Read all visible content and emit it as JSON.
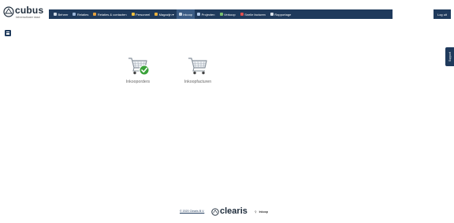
{
  "logo": {
    "name": "cubus",
    "tagline": "beheersoftware totaal"
  },
  "nav": {
    "items": [
      {
        "label": "Beheer",
        "icon": "gear-icon",
        "color": "#cfd8e3"
      },
      {
        "label": "Relaties",
        "icon": "users-icon",
        "color": "#9ab4d6"
      },
      {
        "label": "Relaties & contacten",
        "icon": "contacts-icon",
        "color": "#e2a040"
      },
      {
        "label": "Personeel",
        "icon": "staff-icon",
        "color": "#f0c040"
      },
      {
        "label": "Magazijn",
        "icon": "warehouse-icon",
        "color": "#e8b040",
        "dropdown": "▾"
      },
      {
        "label": "Inkoop",
        "icon": "cart-icon",
        "color": "#c9d6e6",
        "active": true
      },
      {
        "label": "Projecten",
        "icon": "projects-icon",
        "color": "#b0c8e8"
      },
      {
        "label": "Verkoop",
        "icon": "sales-icon",
        "color": "#7ac070"
      },
      {
        "label": "Snelle facturen",
        "icon": "invoice-icon",
        "color": "#e05050"
      },
      {
        "label": "Rapportage",
        "icon": "report-icon",
        "color": "#d8e0ea"
      }
    ],
    "logout": "Log uit"
  },
  "support_label": "Support",
  "tiles": [
    {
      "label": "Inkooporders",
      "icon": "shopping-cart-check-icon"
    },
    {
      "label": "Inkoopfacturen",
      "icon": "shopping-cart-icon"
    }
  ],
  "footer": {
    "copyright": "© 2020 Clearis B.V.",
    "brand": "clearis",
    "section": "Inkoop"
  },
  "colors": {
    "nav_bg": "#1f3a5c",
    "nav_active": "#3b5c85",
    "check": "#3aa23a"
  }
}
